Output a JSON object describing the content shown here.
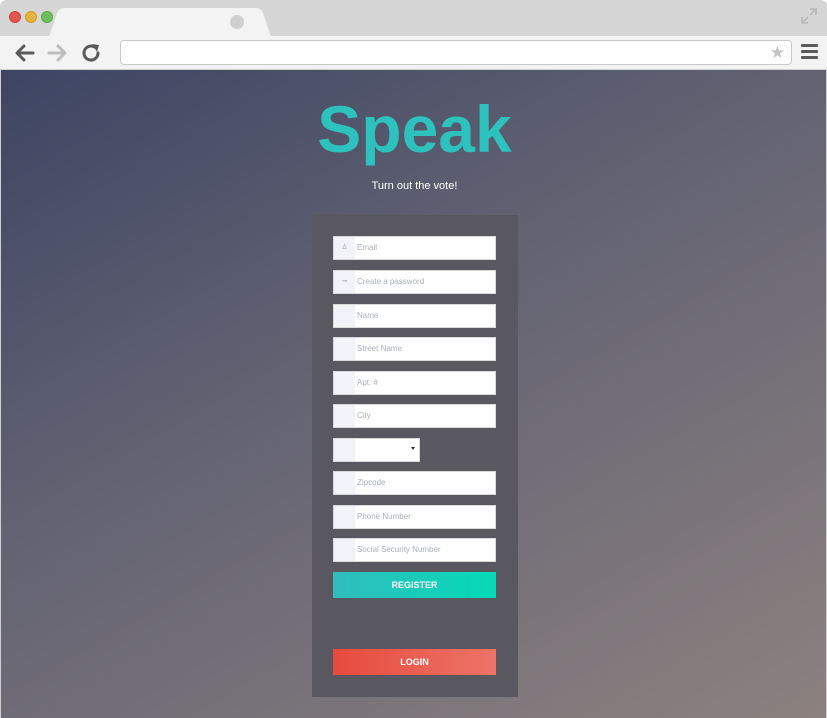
{
  "page": {
    "brand": "Speak",
    "tagline": "Turn out the vote!"
  },
  "form": {
    "email_placeholder": "Email",
    "password_placeholder": "Create a password",
    "name_placeholder": "Name",
    "street_placeholder": "Street Name",
    "apt_placeholder": "Apt. #",
    "city_placeholder": "City",
    "state_value": "",
    "zipcode_placeholder": "Zipcode",
    "phone_placeholder": "Phone Number",
    "ssn_placeholder": "Social Security Number",
    "register_label": "REGISTER",
    "login_label": "LOGIN"
  },
  "icons": {
    "email_icon": "person-icon",
    "password_icon": "key-icon"
  },
  "colors": {
    "brand": "#2ec2be",
    "register": "#05d9b8",
    "login": "#e64b3c",
    "panel": "#59575f"
  }
}
